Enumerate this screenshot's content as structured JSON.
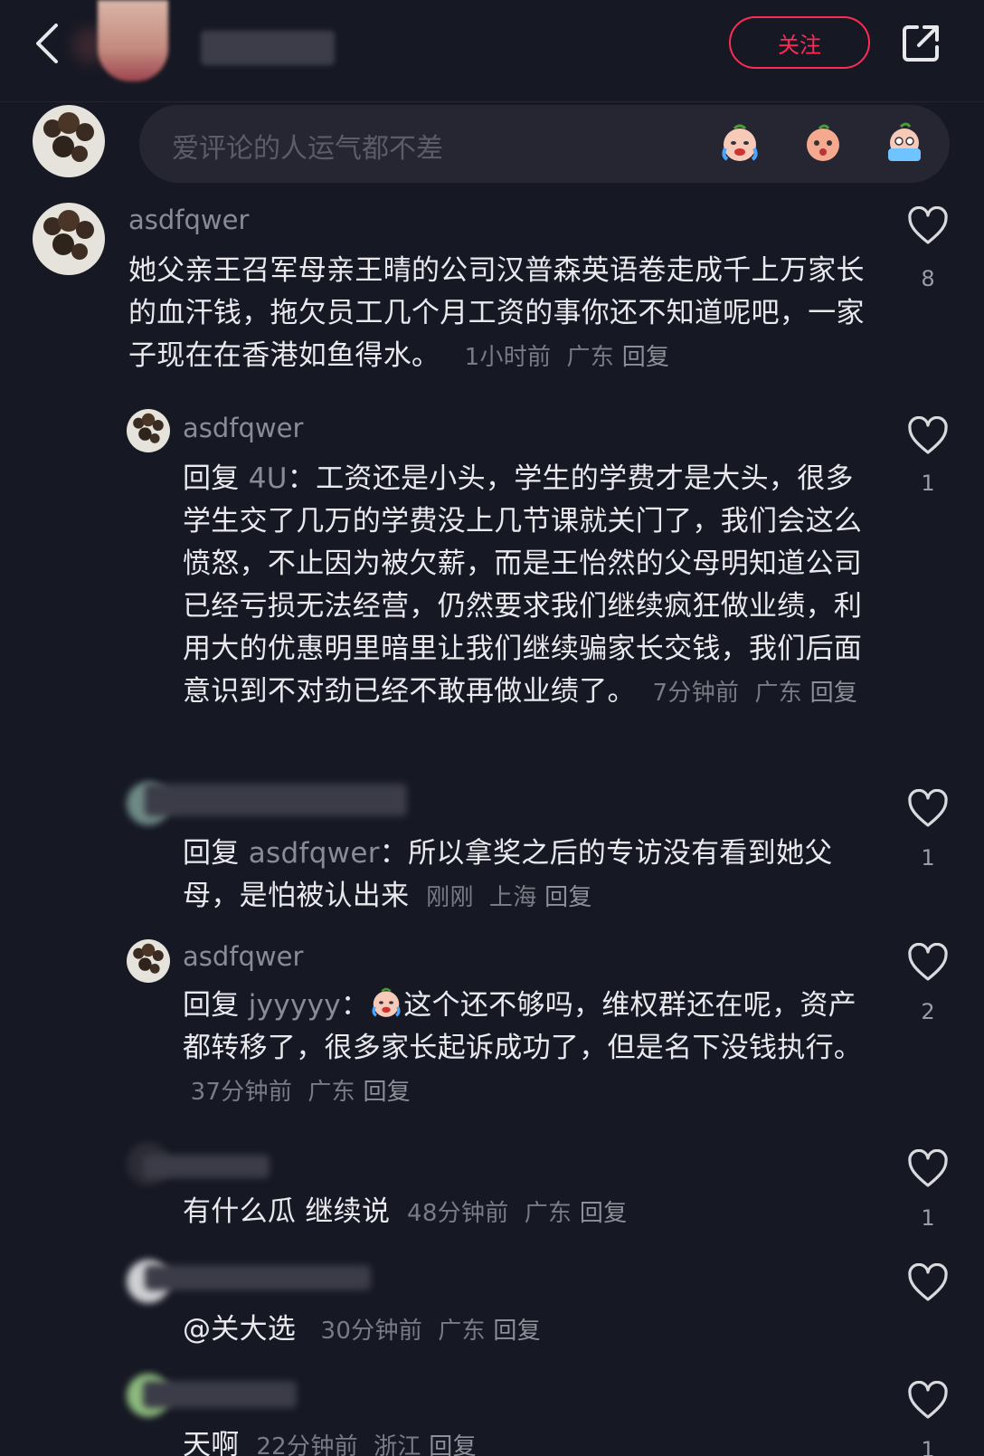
{
  "header": {
    "follow_label": "关注"
  },
  "input": {
    "placeholder": "爱评论的人运气都不差"
  },
  "comments": [
    {
      "username": "asdfqwer",
      "text": "她父亲王召军母亲王晴的公司汉普森英语卷走成千上万家长的血汗钱，拖欠员工几个月工资的事你还不知道呢吧，一家子现在在香港如鱼得水。",
      "time": "1小时前",
      "location": "广东",
      "reply_label": "回复",
      "likes": "8"
    }
  ],
  "replies": [
    {
      "username": "asdfqwer",
      "reply_prefix": "回复",
      "reply_target": "4U",
      "text": "工资还是小头，学生的学费才是大头，很多学生交了几万的学费没上几节课就关门了，我们会这么愤怒，不止因为被欠薪，而是王怡然的父母明知道公司已经亏损无法经营，仍然要求我们继续疯狂做业绩，利用大的优惠明里暗里让我们继续骗家长交钱，我们后面意识到不对劲已经不敢再做业绩了。",
      "time": "7分钟前",
      "location": "广东",
      "reply_label": "回复",
      "likes": "1"
    },
    {
      "reply_prefix": "回复",
      "reply_target": "asdfqwer",
      "text": "所以拿奖之后的专访没有看到她父母，是怕被认出来",
      "time": "刚刚",
      "location": "上海",
      "reply_label": "回复",
      "likes": "1"
    },
    {
      "username": "asdfqwer",
      "reply_prefix": "回复",
      "reply_target": "jyyyyy",
      "text": "这个还不够吗，维权群还在呢，资产都转移了，很多家长起诉成功了，但是名下没钱执行。",
      "time": "37分钟前",
      "location": "广东",
      "reply_label": "回复",
      "likes": "2"
    },
    {
      "text": "有什么瓜 继续说",
      "time": "48分钟前",
      "location": "广东",
      "reply_label": "回复",
      "likes": "1"
    },
    {
      "text": "@关大选",
      "time": "30分钟前",
      "location": "广东",
      "reply_label": "回复"
    },
    {
      "text": "天啊",
      "time": "22分钟前",
      "location": "浙江",
      "reply_label": "回复",
      "likes": "1"
    }
  ],
  "colors": {
    "background": "#161823",
    "accent": "#fe2c55",
    "text_primary": "#e9e9ee",
    "text_secondary": "#8a8b94"
  },
  "icons": [
    "back-arrow-icon",
    "share-icon",
    "heart-outline-icon",
    "crying-face-emoji",
    "peach-face-emoji",
    "sobbing-face-emoji"
  ]
}
